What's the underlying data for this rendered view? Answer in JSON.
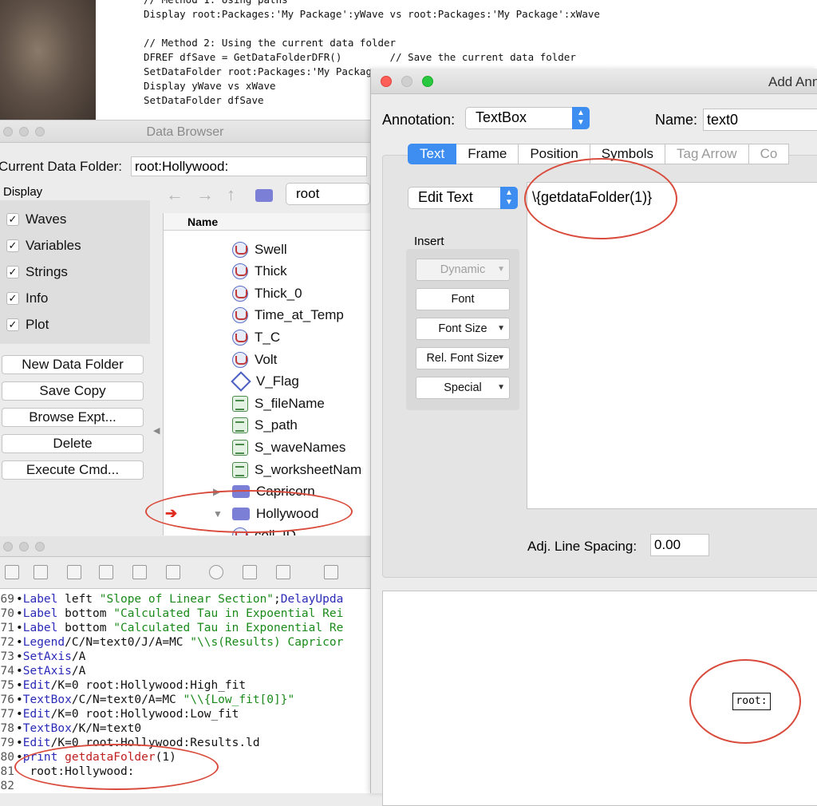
{
  "code": {
    "lines": [
      "// Method 1: Using paths",
      "Display root:Packages:'My Package':yWave vs root:Packages:'My Package':xWave",
      "",
      "// Method 2: Using the current data folder",
      "DFREF dfSave = GetDataFolderDFR()        // Save the current data folder",
      "SetDataFolder root:Packages:'My Packag",
      "Display yWave vs xWave",
      "SetDataFolder dfSave"
    ]
  },
  "data_browser": {
    "title": "Data Browser",
    "current_folder_label": "Current Data Folder:",
    "current_folder_value": "root:Hollywood:",
    "display_label": "Display",
    "checkboxes": [
      {
        "label": "Waves",
        "checked": "✓"
      },
      {
        "label": "Variables",
        "checked": "✓"
      },
      {
        "label": "Strings",
        "checked": "✓"
      },
      {
        "label": "Info",
        "checked": "✓"
      },
      {
        "label": "Plot",
        "checked": "✓"
      }
    ],
    "buttons": [
      "New Data Folder",
      "Save Copy",
      "Browse Expt...",
      "Delete",
      "Execute Cmd..."
    ],
    "nav": {
      "back": "←",
      "forward": "→",
      "up": "↑"
    },
    "folder_popup": "root",
    "tree_header": "Name",
    "tree_items": [
      {
        "name": "Swell",
        "icon": "wave-icon"
      },
      {
        "name": "Thick",
        "icon": "wave-icon"
      },
      {
        "name": "Thick_0",
        "icon": "wave-icon"
      },
      {
        "name": "Time_at_Temp",
        "icon": "wave-icon"
      },
      {
        "name": "T_C",
        "icon": "wave-icon"
      },
      {
        "name": "Volt",
        "icon": "wave-icon"
      },
      {
        "name": "V_Flag",
        "icon": "variable-icon"
      },
      {
        "name": "S_fileName",
        "icon": "string-icon"
      },
      {
        "name": "S_path",
        "icon": "string-icon"
      },
      {
        "name": "S_waveNames",
        "icon": "string-icon"
      },
      {
        "name": "S_worksheetNam",
        "icon": "string-icon"
      },
      {
        "name": "Capricorn",
        "icon": "folder-icon"
      },
      {
        "name": "Hollywood",
        "icon": "folder-icon"
      },
      {
        "name": "coll_ID",
        "icon": "wave-icon"
      }
    ],
    "current_marker": "➔",
    "expand_collapsed": "▶",
    "expand_open": "▼"
  },
  "command_window": {
    "lines": [
      {
        "num": "69",
        "segments": [
          {
            "t": "•"
          },
          {
            "t": "Label",
            "c": "kw"
          },
          {
            "t": " left "
          },
          {
            "t": "\"Slope of Linear Section\"",
            "c": "str"
          },
          {
            "t": ";"
          },
          {
            "t": "DelayUpda",
            "c": "kw"
          }
        ]
      },
      {
        "num": "70",
        "segments": [
          {
            "t": "•"
          },
          {
            "t": "Label",
            "c": "kw"
          },
          {
            "t": " bottom "
          },
          {
            "t": "\"Calculated Tau in Expoential Rei",
            "c": "str"
          }
        ]
      },
      {
        "num": "71",
        "segments": [
          {
            "t": "•"
          },
          {
            "t": "Label",
            "c": "kw"
          },
          {
            "t": " bottom "
          },
          {
            "t": "\"Calculated Tau in Exponential Re",
            "c": "str"
          }
        ]
      },
      {
        "num": "72",
        "segments": [
          {
            "t": "•"
          },
          {
            "t": "Legend",
            "c": "kw"
          },
          {
            "t": "/C/N=text0/J/A=MC "
          },
          {
            "t": "\"\\\\s(Results) Capricor",
            "c": "str"
          }
        ]
      },
      {
        "num": "73",
        "segments": [
          {
            "t": "•"
          },
          {
            "t": "SetAxis",
            "c": "kw"
          },
          {
            "t": "/A"
          }
        ]
      },
      {
        "num": "74",
        "segments": [
          {
            "t": "•"
          },
          {
            "t": "SetAxis",
            "c": "kw"
          },
          {
            "t": "/A"
          }
        ]
      },
      {
        "num": "75",
        "segments": [
          {
            "t": "•"
          },
          {
            "t": "Edit",
            "c": "kw"
          },
          {
            "t": "/K=0 root:Hollywood:High_fit"
          }
        ]
      },
      {
        "num": "76",
        "segments": [
          {
            "t": "•"
          },
          {
            "t": "TextBox",
            "c": "kw"
          },
          {
            "t": "/C/N=text0/A=MC "
          },
          {
            "t": "\"\\\\{Low_fit[0]}\"",
            "c": "str"
          }
        ]
      },
      {
        "num": "77",
        "segments": [
          {
            "t": "•"
          },
          {
            "t": "Edit",
            "c": "kw"
          },
          {
            "t": "/K=0 root:Hollywood:Low_fit"
          }
        ]
      },
      {
        "num": "78",
        "segments": [
          {
            "t": "•"
          },
          {
            "t": "TextBox",
            "c": "kw"
          },
          {
            "t": "/K/N=text0"
          }
        ]
      },
      {
        "num": "79",
        "segments": [
          {
            "t": "•"
          },
          {
            "t": "Edit",
            "c": "kw"
          },
          {
            "t": "/K=0 root:Hollywood:Results.ld"
          }
        ]
      },
      {
        "num": "80",
        "segments": [
          {
            "t": "•"
          },
          {
            "t": "print",
            "c": "kw"
          },
          {
            "t": " "
          },
          {
            "t": "getdataFolder",
            "c": "fn"
          },
          {
            "t": "(1)"
          }
        ]
      },
      {
        "num": "81",
        "segments": [
          {
            "t": "  root:Hollywood:"
          }
        ]
      },
      {
        "num": "82",
        "segments": [
          {
            "t": ""
          }
        ]
      }
    ]
  },
  "annotation_dialog": {
    "title": "Add Ann",
    "annotation_label": "Annotation:",
    "annotation_type": "TextBox",
    "name_label": "Name:",
    "name_value": "text0",
    "tabs": [
      {
        "label": "Text",
        "state": "active"
      },
      {
        "label": "Frame",
        "state": "normal"
      },
      {
        "label": "Position",
        "state": "normal"
      },
      {
        "label": "Symbols",
        "state": "normal"
      },
      {
        "label": "Tag Arrow",
        "state": "disabled"
      },
      {
        "label": "Co",
        "state": "disabled"
      }
    ],
    "edit_mode": "Edit Text",
    "insert_label": "Insert",
    "insert_buttons": [
      {
        "label": "Dynamic",
        "disabled": true,
        "caret": "▼"
      },
      {
        "label": "Font",
        "disabled": false,
        "caret": ""
      },
      {
        "label": "Font Size",
        "disabled": false,
        "caret": "▼"
      },
      {
        "label": "Rel. Font Size",
        "disabled": false,
        "caret": "▼"
      },
      {
        "label": "Special",
        "disabled": false,
        "caret": "▼"
      }
    ],
    "text_content": "\\{getdataFolder(1)}",
    "line_spacing_label": "Adj. Line Spacing:",
    "line_spacing_value": "0.00",
    "preview_text": "root:",
    "stepper_glyph": "⌃⌄"
  },
  "colors": {
    "accent": "#3d8ef0",
    "annotation_circle": "#d94b3c",
    "traffic_close": "#fc5f57",
    "traffic_min": "#cfcfcf",
    "traffic_max": "#28c840"
  }
}
